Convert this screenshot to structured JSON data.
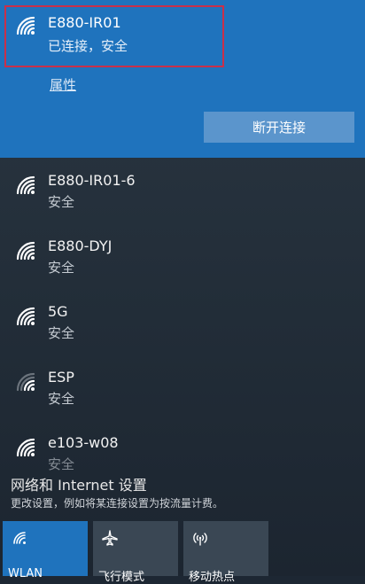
{
  "connected": {
    "name": "E880-IR01",
    "status": "已连接，安全",
    "properties_link": "属性",
    "disconnect_label": "断开连接"
  },
  "networks": [
    {
      "name": "E880-IR01-6",
      "security": "安全",
      "signal": "strong"
    },
    {
      "name": "E880-DYJ",
      "security": "安全",
      "signal": "strong"
    },
    {
      "name": "5G",
      "security": "安全",
      "signal": "strong"
    },
    {
      "name": "ESP",
      "security": "安全",
      "signal": "weak"
    },
    {
      "name": "e103-w08",
      "security": "安全",
      "signal": "strong"
    }
  ],
  "settings": {
    "title": "网络和 Internet 设置",
    "description": "更改设置，例如将某连接设置为按流量计费。"
  },
  "quick_actions": [
    {
      "label": "WLAN",
      "icon": "wifi-icon",
      "active": true
    },
    {
      "label": "飞行模式",
      "icon": "airplane-icon",
      "active": false
    },
    {
      "label": "移动热点",
      "icon": "hotspot-icon",
      "active": false
    }
  ],
  "colors": {
    "accent": "#1f73bd",
    "highlight_border": "#c9304a",
    "panel_bg": "#222d38"
  }
}
